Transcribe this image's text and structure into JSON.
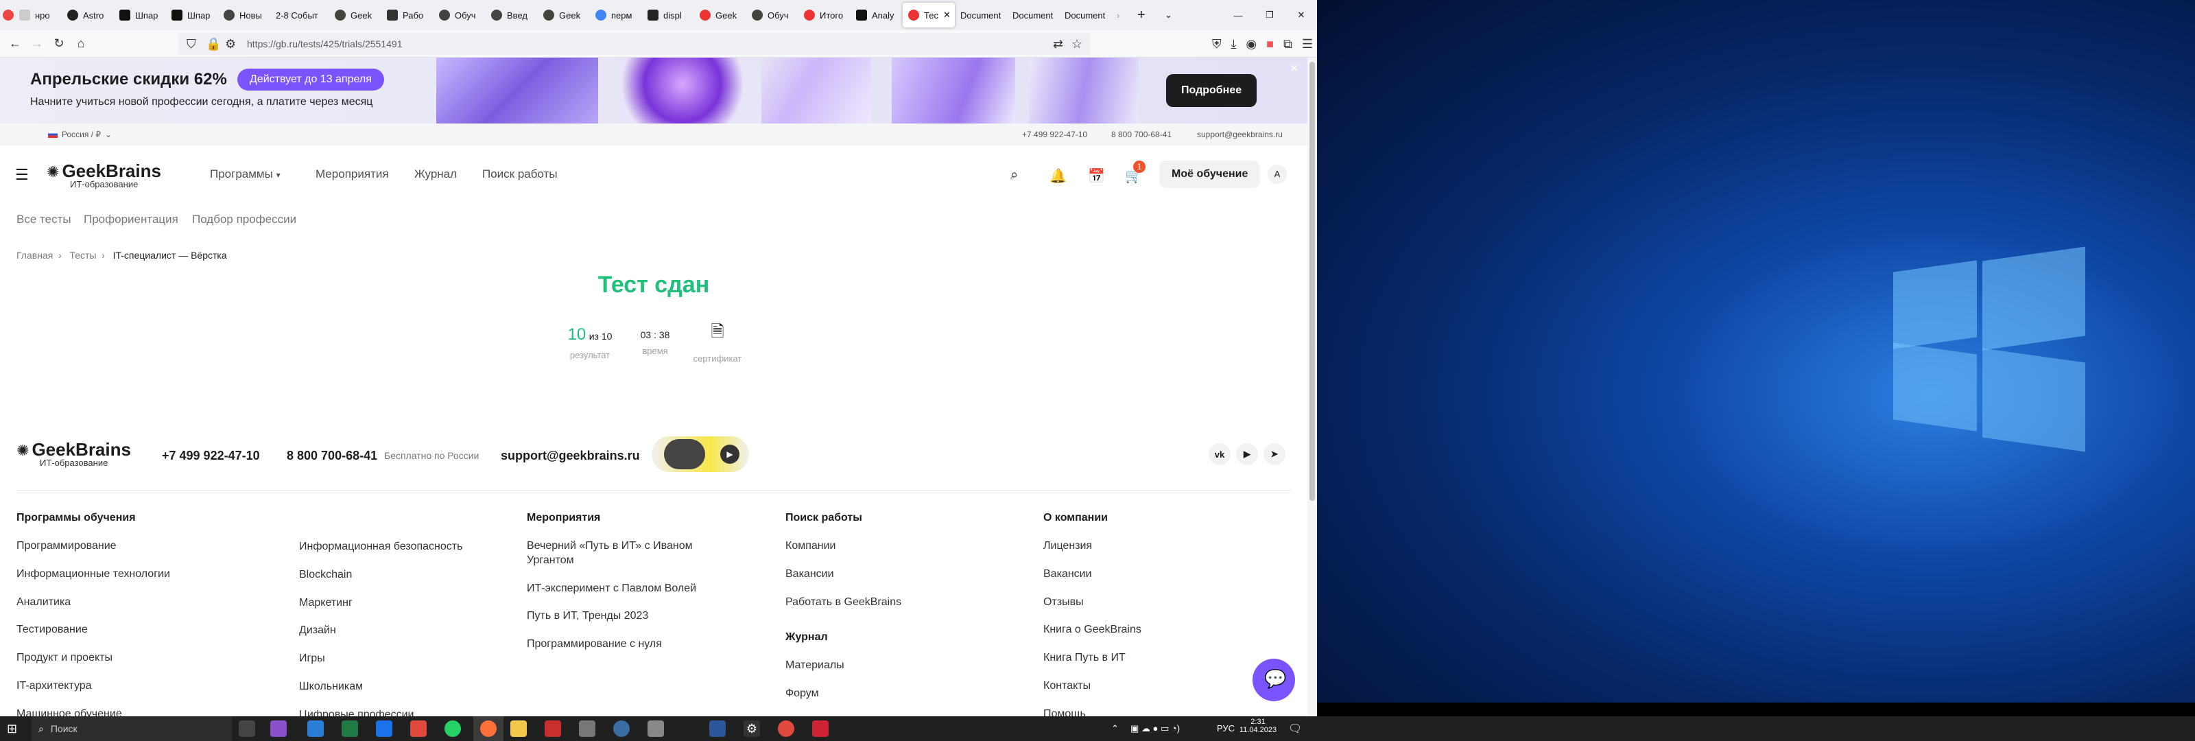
{
  "browser": {
    "tabs": [
      {
        "label": "нро"
      },
      {
        "label": "Astro"
      },
      {
        "label": "Шпар"
      },
      {
        "label": "Шпар"
      },
      {
        "label": "Новы"
      },
      {
        "label": "2-8 Событ"
      },
      {
        "label": "Geek"
      },
      {
        "label": "Рабо"
      },
      {
        "label": "Обуч"
      },
      {
        "label": "Введ"
      },
      {
        "label": "Geek"
      },
      {
        "label": "перм"
      },
      {
        "label": "displ"
      },
      {
        "label": "Geek"
      },
      {
        "label": "Обуч"
      },
      {
        "label": "Итого"
      },
      {
        "label": "Analy"
      },
      {
        "label": "Тес"
      },
      {
        "label": "Document"
      },
      {
        "label": "Document"
      },
      {
        "label": "Document"
      }
    ],
    "url": "https://gb.ru/tests/425/trials/2551491"
  },
  "banner": {
    "title": "Апрельские скидки 62%",
    "pill": "Действует до 13 апреля",
    "subtitle": "Начните учиться новой профессии сегодня, а платите через месяц",
    "button": "Подробнее"
  },
  "topstrip": {
    "region": "Россия / ₽",
    "phone1": "+7 499 922-47-10",
    "phone2": "8 800 700-68-41",
    "email": "support@geekbrains.ru"
  },
  "header": {
    "logo": "GeekBrains",
    "logo_sub": "ИТ-образование",
    "nav": [
      "Программы",
      "Мероприятия",
      "Журнал",
      "Поиск работы"
    ],
    "cart_count": "1",
    "my_learning": "Моё обучение",
    "avatar": "A"
  },
  "subnav": [
    "Все тесты",
    "Профориентация",
    "Подбор профессии"
  ],
  "breadcrumbs": [
    "Главная",
    "Тесты",
    "IT-специалист — Вёрстка"
  ],
  "result": {
    "title": "Тест сдан",
    "score": "10",
    "score_of": "из 10",
    "score_label": "результат",
    "time": "03 : 38",
    "time_label": "время",
    "cert_label": "сертификат"
  },
  "footer": {
    "logo": "GeekBrains",
    "logo_sub": "ИТ-образование",
    "phone1": "+7 499 922-47-10",
    "phone2": "8 800 700-68-41",
    "phone2_note": "Бесплатно по России",
    "email": "support@geekbrains.ru",
    "social": [
      "vk",
      "youtube",
      "telegram"
    ],
    "columns": [
      {
        "title": "Программы обучения",
        "items": [
          "Программирование",
          "Информационные технологии",
          "Аналитика",
          "Тестирование",
          "Продукт и проекты",
          "IT-архитектура",
          "Машинное обучение"
        ]
      },
      {
        "title": "",
        "items": [
          "Информационная безопасность",
          "Blockchain",
          "Маркетинг",
          "Дизайн",
          "Игры",
          "Школьникам",
          "Цифровые профессии"
        ]
      },
      {
        "title": "Мероприятия",
        "items": [
          "Вечерний «Путь в ИТ» с Иваном Ургантом",
          "ИТ-эксперимент с Павлом Волей",
          "Путь в ИТ, Тренды 2023",
          "Программирование с нуля"
        ]
      },
      {
        "title": "Поиск работы",
        "items": [
          "Компании",
          "Вакансии",
          "Работать в GeekBrains"
        ]
      },
      {
        "title": "Журнал",
        "items": [
          "Материалы",
          "Форум"
        ]
      },
      {
        "title": "О компании",
        "items": [
          "Лицензия",
          "Вакансии",
          "Отзывы",
          "Книга о GeekBrains",
          "Книга Путь в ИТ",
          "Контакты",
          "Помощь"
        ]
      }
    ]
  },
  "taskbar": {
    "search": "Поиск",
    "lang": "РУС",
    "time": "2:31",
    "date": "11.04.2023"
  },
  "colors": {
    "accent": "#7a55ff",
    "success": "#20c07c",
    "dark": "#1d1d1f"
  }
}
